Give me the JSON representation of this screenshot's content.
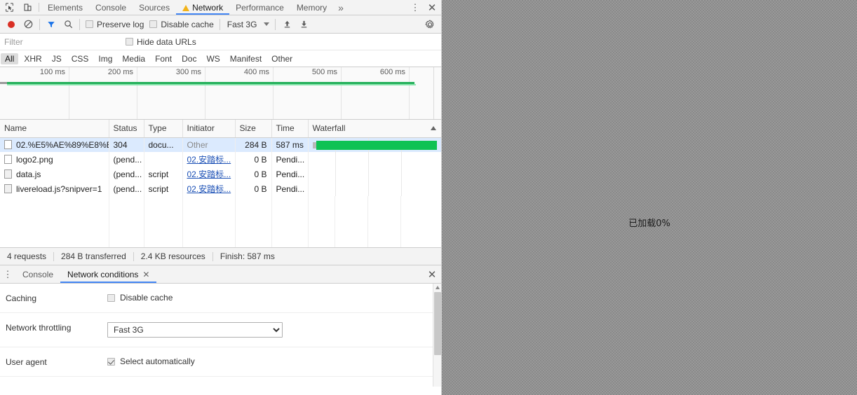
{
  "tabstrip": {
    "inspect_icon": "inspect-cursor-icon",
    "device_icon": "device-toolbar-icon",
    "tabs": [
      {
        "label": "Elements",
        "active": false,
        "warn": false
      },
      {
        "label": "Console",
        "active": false,
        "warn": false
      },
      {
        "label": "Sources",
        "active": false,
        "warn": false
      },
      {
        "label": "Network",
        "active": true,
        "warn": true
      },
      {
        "label": "Performance",
        "active": false,
        "warn": false
      },
      {
        "label": "Memory",
        "active": false,
        "warn": false
      }
    ],
    "more_label": "»",
    "kebab_label": "⋮",
    "close_label": "✕"
  },
  "net_toolbar": {
    "record_icon": "record-icon",
    "clear_icon": "clear-icon",
    "filter_icon": "filter-funnel-icon",
    "search_icon": "search-icon",
    "preserve_log_label": "Preserve log",
    "preserve_log_checked": false,
    "disable_cache_label": "Disable cache",
    "disable_cache_checked": false,
    "throttle_value": "Fast 3G",
    "import_icon": "import-har-icon",
    "export_icon": "export-har-icon",
    "settings_icon": "gear-icon"
  },
  "filter_bar": {
    "filter_placeholder": "Filter",
    "filter_value": "",
    "hide_data_urls_label": "Hide data URLs",
    "hide_data_urls_checked": false
  },
  "type_filters": [
    {
      "label": "All",
      "active": true
    },
    {
      "label": "XHR",
      "active": false
    },
    {
      "label": "JS",
      "active": false
    },
    {
      "label": "CSS",
      "active": false
    },
    {
      "label": "Img",
      "active": false
    },
    {
      "label": "Media",
      "active": false
    },
    {
      "label": "Font",
      "active": false
    },
    {
      "label": "Doc",
      "active": false
    },
    {
      "label": "WS",
      "active": false
    },
    {
      "label": "Manifest",
      "active": false
    },
    {
      "label": "Other",
      "active": false
    }
  ],
  "overview": {
    "ticks": [
      "100 ms",
      "200 ms",
      "300 ms",
      "400 ms",
      "500 ms",
      "600 ms"
    ]
  },
  "table": {
    "columns": [
      "Name",
      "Status",
      "Type",
      "Initiator",
      "Size",
      "Time",
      "Waterfall"
    ],
    "sort_column": "Waterfall",
    "sort_direction": "asc",
    "rows": [
      {
        "name": "02.%E5%AE%89%E8%B...",
        "status": "304",
        "type": "docu...",
        "initiator": "Other",
        "initiator_kind": "plain",
        "size": "284 B",
        "time": "587 ms",
        "selected": true,
        "icon": "document-icon",
        "wf_start_pct": 2,
        "wf_width_pct": 95
      },
      {
        "name": "logo2.png",
        "status": "(pend...",
        "type": "",
        "initiator": "02.安踏标...",
        "initiator_kind": "link",
        "size": "0 B",
        "time": "Pendi...",
        "selected": false,
        "icon": "image-icon",
        "wf_start_pct": 0,
        "wf_width_pct": 0
      },
      {
        "name": "data.js",
        "status": "(pend...",
        "type": "script",
        "initiator": "02.安踏标...",
        "initiator_kind": "link",
        "size": "0 B",
        "time": "Pendi...",
        "selected": false,
        "icon": "script-icon",
        "wf_start_pct": 0,
        "wf_width_pct": 0
      },
      {
        "name": "livereload.js?snipver=1",
        "status": "(pend...",
        "type": "script",
        "initiator": "02.安踏标...",
        "initiator_kind": "link",
        "size": "0 B",
        "time": "Pendi...",
        "selected": false,
        "icon": "script-icon",
        "wf_start_pct": 0,
        "wf_width_pct": 0
      }
    ]
  },
  "summary": {
    "requests": "4 requests",
    "transferred": "284 B transferred",
    "resources": "2.4 KB resources",
    "finish": "Finish: 587 ms"
  },
  "drawer": {
    "kebab_label": "⋮",
    "tabs": [
      {
        "label": "Console",
        "active": false,
        "closeable": false
      },
      {
        "label": "Network conditions",
        "active": true,
        "closeable": true,
        "close_label": "✕"
      }
    ],
    "close_label": "✕"
  },
  "network_conditions": {
    "caching_label": "Caching",
    "disable_cache_label": "Disable cache",
    "disable_cache_checked": false,
    "throttling_label": "Network throttling",
    "throttling_value": "Fast 3G",
    "throttling_options": [
      "Fast 3G"
    ],
    "user_agent_label": "User agent",
    "select_automatically_label": "Select automatically",
    "select_automatically_checked": true
  },
  "page": {
    "loading_text": "已加载0%"
  },
  "colors": {
    "accent": "#4285f4",
    "waterfall_green": "#0ec254",
    "overview_green": "#25b05b",
    "record_red": "#d93025",
    "warning_yellow": "#f2b31a",
    "selected_row": "#dbeafe",
    "page_bg": "#999999"
  }
}
